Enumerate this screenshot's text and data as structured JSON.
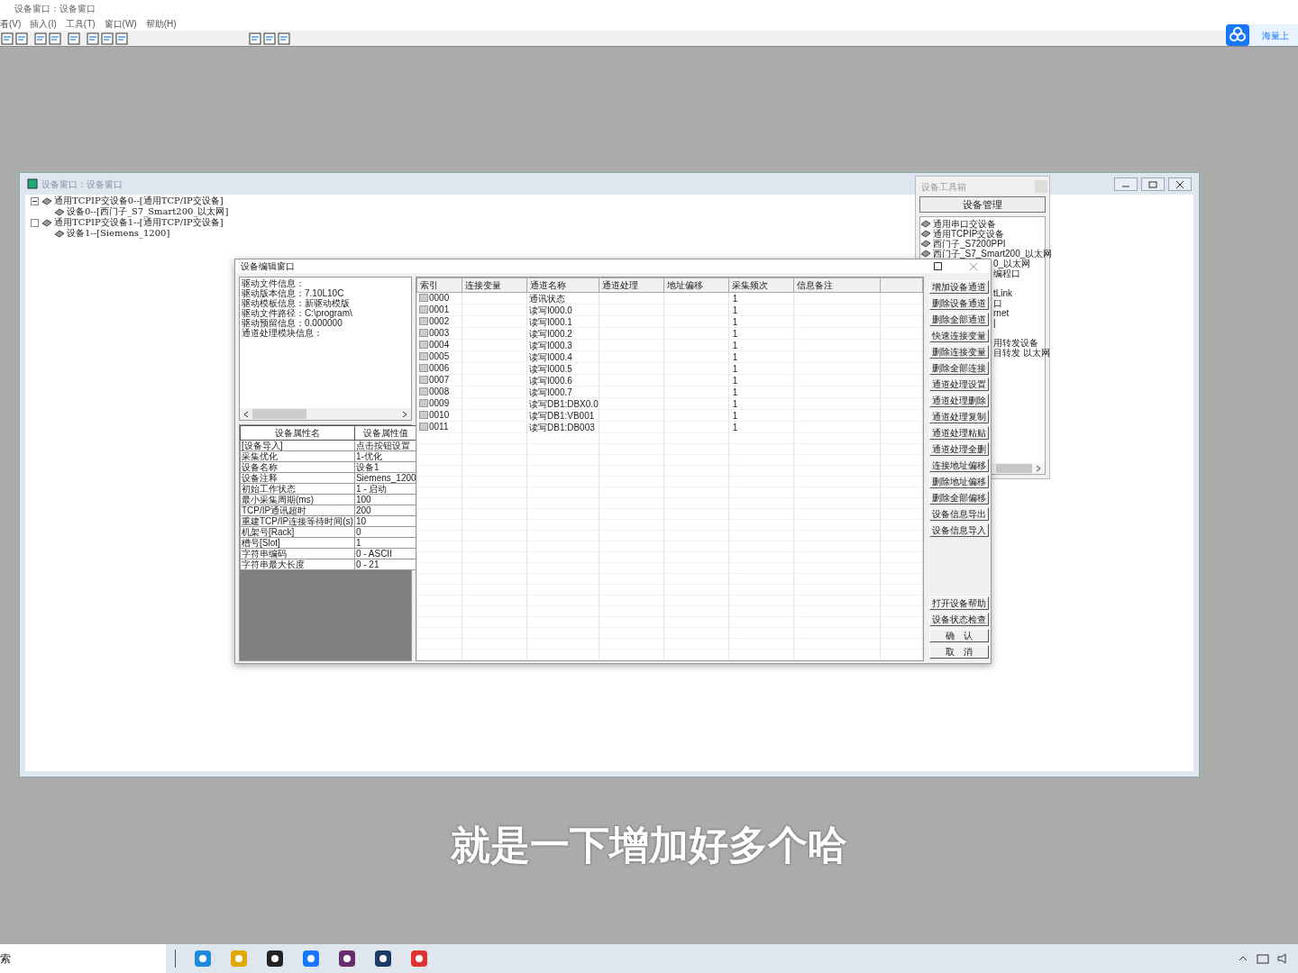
{
  "app": {
    "title": "设备窗口：设备窗口",
    "menu": [
      "看(V)",
      "插入(I)",
      "工具(T)",
      "窗口(W)",
      "帮助(H)"
    ],
    "cloud_badge": "海量上"
  },
  "device_window": {
    "title": "设备窗口：设备窗口",
    "tree": [
      {
        "label": "通用TCPIP交设备0--[通用TCP/IP交设备]",
        "expanded": true,
        "children": [
          {
            "label": "设备0--[西门子_S7_Smart200_以太网]"
          }
        ]
      },
      {
        "label": "通用TCPIP交设备1--[通用TCP/IP交设备]",
        "expanded": false,
        "children": [
          {
            "label": "设备1--[Siemens_1200]"
          }
        ]
      }
    ]
  },
  "toolbox": {
    "title": "设备工具箱",
    "header_button": "设备管理",
    "items": [
      {
        "label": "通用串口交设备",
        "kind": "full"
      },
      {
        "label": "通用TCPIP交设备",
        "kind": "full"
      },
      {
        "label": "西门子_S7200PPI",
        "kind": "full"
      },
      {
        "label": "西门子_S7_Smart200_以太网",
        "kind": "full"
      },
      {
        "label": "0_以太网",
        "kind": "clipped"
      },
      {
        "label": "编程口",
        "kind": "clipped"
      },
      {
        "kind": "gap"
      },
      {
        "label": "tLink",
        "kind": "clipped"
      },
      {
        "label": "口",
        "kind": "clipped"
      },
      {
        "label": "rnet",
        "kind": "clipped"
      },
      {
        "label": "|",
        "kind": "clipped"
      },
      {
        "kind": "gap"
      },
      {
        "label": "用转发设备",
        "kind": "clipped"
      },
      {
        "label": "目转发 以太网",
        "kind": "clipped"
      }
    ]
  },
  "dialog": {
    "title": "设备编辑窗口",
    "info_lines": [
      "驱动文件信息：",
      "驱动版本信息：7.10L10C",
      "驱动模板信息：新驱动模版",
      "驱动文件路径：C:\\program\\",
      "驱动预留信息：0.000000",
      "通道处理模块信息："
    ],
    "property_columns": [
      "设备属性名",
      "设备属性值"
    ],
    "properties": [
      [
        "[设备导入]",
        "点击按钮设置"
      ],
      [
        "采集优化",
        "1-优化"
      ],
      [
        "设备名称",
        "设备1"
      ],
      [
        "设备注释",
        "Siemens_1200"
      ],
      [
        "初始工作状态",
        "1 - 启动"
      ],
      [
        "最小采集周期(ms)",
        "100"
      ],
      [
        "TCP/IP通讯超时",
        "200"
      ],
      [
        "重建TCP/IP连接等待时间(s)",
        "10"
      ],
      [
        "机架号[Rack]",
        "0"
      ],
      [
        "槽号[Slot]",
        "1"
      ],
      [
        "字符串编码",
        "0 - ASCII"
      ],
      [
        "字符串最大长度",
        "0 - 21"
      ]
    ],
    "table": {
      "columns": [
        "索引",
        "连接变量",
        "通道名称",
        "通道处理",
        "地址偏移",
        "采集频次",
        "信息备注"
      ],
      "rows": [
        [
          "0000",
          "",
          "通讯状态",
          "",
          "",
          "1",
          ""
        ],
        [
          "0001",
          "",
          "读写I000.0",
          "",
          "",
          "1",
          ""
        ],
        [
          "0002",
          "",
          "读写I000.1",
          "",
          "",
          "1",
          ""
        ],
        [
          "0003",
          "",
          "读写I000.2",
          "",
          "",
          "1",
          ""
        ],
        [
          "0004",
          "",
          "读写I000.3",
          "",
          "",
          "1",
          ""
        ],
        [
          "0005",
          "",
          "读写I000.4",
          "",
          "",
          "1",
          ""
        ],
        [
          "0006",
          "",
          "读写I000.5",
          "",
          "",
          "1",
          ""
        ],
        [
          "0007",
          "",
          "读写I000.6",
          "",
          "",
          "1",
          ""
        ],
        [
          "0008",
          "",
          "读写I000.7",
          "",
          "",
          "1",
          ""
        ],
        [
          "0009",
          "",
          "读写DB1:DBX0.0",
          "",
          "",
          "1",
          ""
        ],
        [
          "0010",
          "",
          "读写DB1:VB001",
          "",
          "",
          "1",
          ""
        ],
        [
          "0011",
          "",
          "读写DB1:DB003",
          "",
          "",
          "1",
          ""
        ]
      ]
    },
    "buttons": [
      "增加设备通道",
      "删除设备通道",
      "删除全部通道",
      "快速连接变量",
      "删除连接变量",
      "删除全部连接",
      "通道处理设置",
      "通道处理删除",
      "通道处理复制",
      "通道处理粘贴",
      "通道处理全删",
      "连接地址偏移",
      "删除地址偏移",
      "删除全部偏移",
      "设备信息导出",
      "设备信息导入"
    ],
    "bottom_buttons": [
      "打开设备帮助",
      "设备状态检查",
      "确　认",
      "取　消"
    ]
  },
  "subtitle": "就是一下增加好多个哈",
  "taskbar": {
    "search_text": "索"
  }
}
